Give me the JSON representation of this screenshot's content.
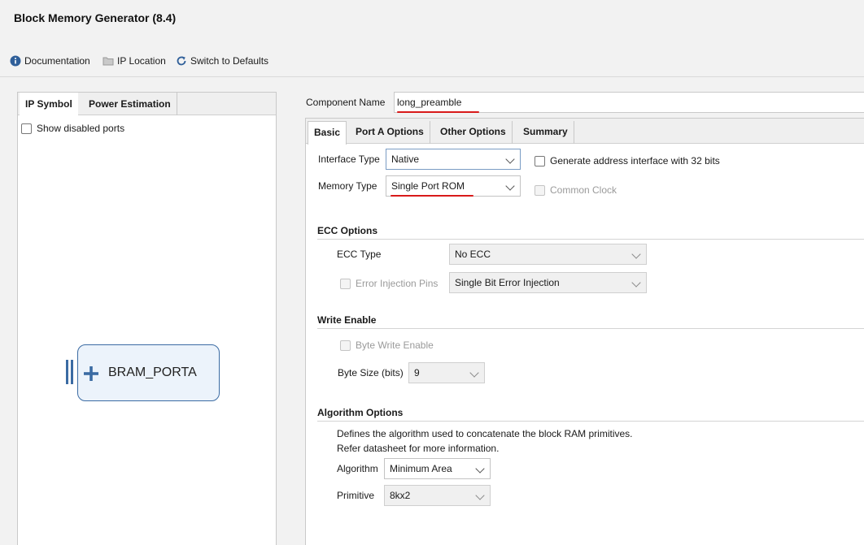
{
  "window": {
    "title": "Block Memory Generator (8.4)"
  },
  "toolbar": {
    "documentation": "Documentation",
    "ip_location": "IP Location",
    "switch_defaults": "Switch to Defaults"
  },
  "left": {
    "tabs": [
      "IP Symbol",
      "Power Estimation"
    ],
    "show_disabled_ports": "Show disabled ports",
    "bram_label": "BRAM_PORTA"
  },
  "component": {
    "label": "Component Name",
    "value": "long_preamble"
  },
  "right_tabs": [
    "Basic",
    "Port A Options",
    "Other Options",
    "Summary"
  ],
  "basic": {
    "interface_type_label": "Interface Type",
    "interface_type_value": "Native",
    "memory_type_label": "Memory Type",
    "memory_type_value": "Single Port ROM",
    "gen_addr_label": "Generate address interface with 32 bits",
    "common_clock_label": "Common Clock"
  },
  "ecc": {
    "section": "ECC Options",
    "type_label": "ECC Type",
    "type_value": "No ECC",
    "injection_label": "Error Injection Pins",
    "injection_value": "Single Bit Error Injection"
  },
  "write_enable": {
    "section": "Write Enable",
    "byte_write_label": "Byte Write Enable",
    "byte_size_label": "Byte Size (bits)",
    "byte_size_value": "9"
  },
  "algorithm": {
    "section": "Algorithm Options",
    "desc_line1": "Defines the algorithm used to concatenate the block RAM primitives.",
    "desc_line2": "Refer datasheet for more information.",
    "algorithm_label": "Algorithm",
    "algorithm_value": "Minimum Area",
    "primitive_label": "Primitive",
    "primitive_value": "8kx2"
  },
  "colors": {
    "accent": "#3b6ba3",
    "annotation": "#d81a1a"
  }
}
